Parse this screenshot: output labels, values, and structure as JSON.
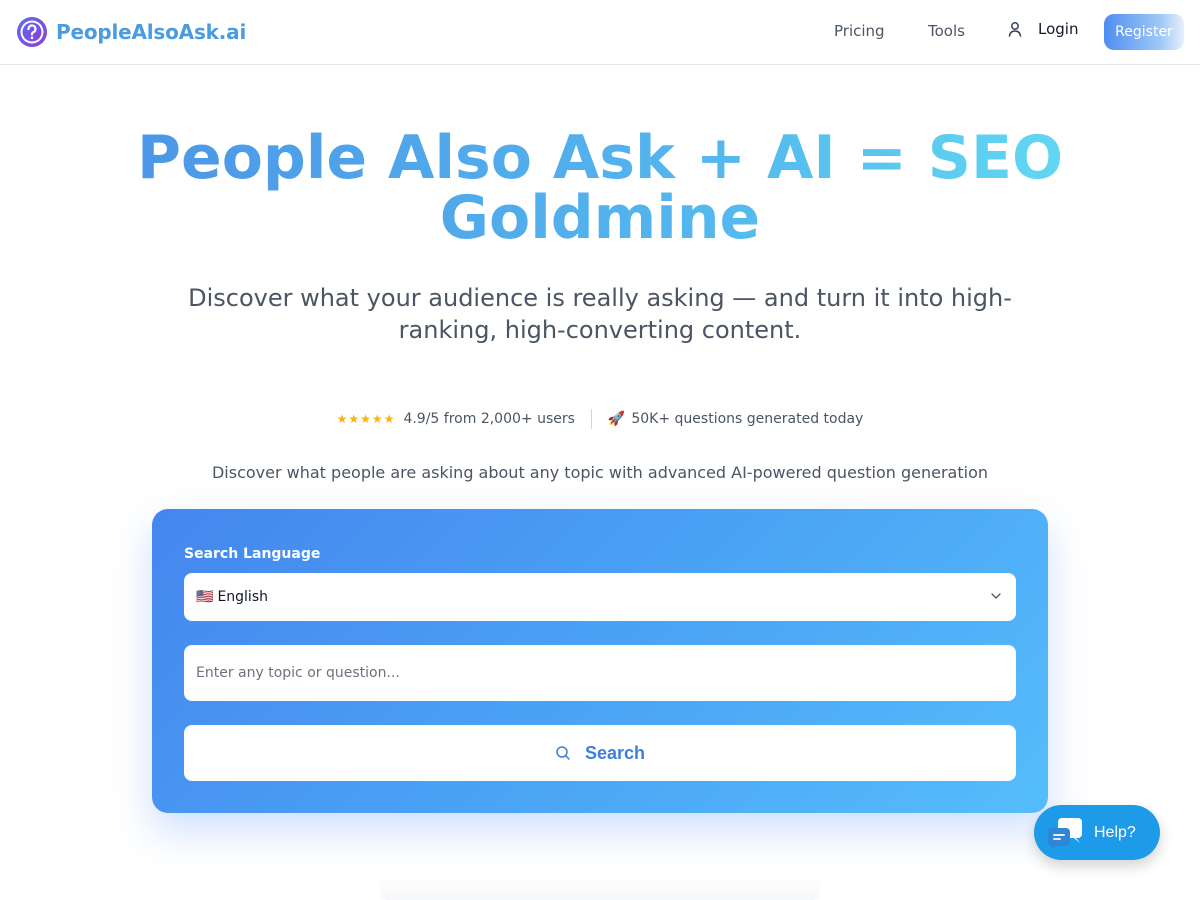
{
  "header": {
    "brand": "PeopleAlsoAsk.ai",
    "nav": {
      "pricing": "Pricing",
      "tools": "Tools",
      "login": "Login",
      "register": "Register"
    }
  },
  "hero": {
    "title_line1": "People Also Ask + AI = SEO",
    "title_line2": "Goldmine",
    "subtitle": "Discover what your audience is really asking — and turn it into high-ranking, high-converting content."
  },
  "stats": {
    "stars": "★★★★★",
    "rating": "4.9/5 from 2,000+ users",
    "rocket": "🚀",
    "generated": "50K+ questions generated today"
  },
  "tagline": "Discover what people are asking about any topic with advanced AI-powered question generation",
  "search": {
    "language_label": "Search Language",
    "flag": "🇺🇸",
    "language_value": "English",
    "placeholder": "Enter any topic or question...",
    "button_label": "Search"
  },
  "help": {
    "label": "Help?"
  },
  "colors": {
    "brand": "#4a9be0",
    "accent": "#3b82f6",
    "help": "#1e9be8",
    "stars": "#f5b50a"
  },
  "icons": {
    "logo": "question-circle-icon",
    "login": "user-icon",
    "select": "chevron-down-icon",
    "search": "search-icon",
    "help": "chat-bubbles-icon"
  }
}
